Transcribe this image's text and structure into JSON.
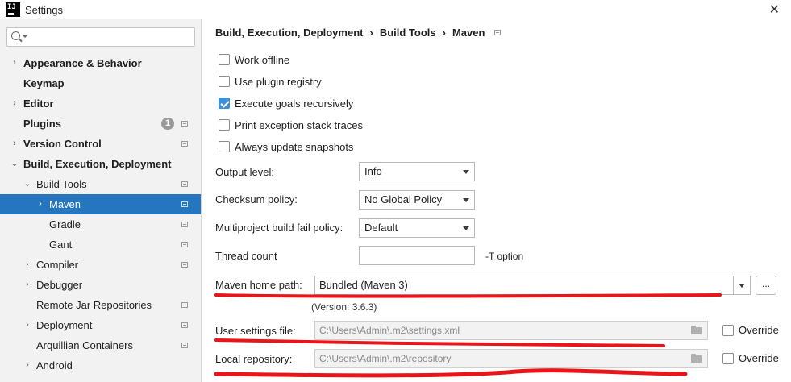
{
  "window": {
    "title": "Settings",
    "app_icon_text": "IJ"
  },
  "sidebar": {
    "search_placeholder": "",
    "items": [
      {
        "label": "Appearance & Behavior",
        "bold": true
      },
      {
        "label": "Keymap",
        "bold": true
      },
      {
        "label": "Editor",
        "bold": true
      },
      {
        "label": "Plugins",
        "bold": true,
        "badge": "1"
      },
      {
        "label": "Version Control",
        "bold": true
      },
      {
        "label": "Build, Execution, Deployment",
        "bold": true
      },
      {
        "label": "Build Tools"
      },
      {
        "label": "Maven",
        "selected": true
      },
      {
        "label": "Gradle"
      },
      {
        "label": "Gant"
      },
      {
        "label": "Compiler"
      },
      {
        "label": "Debugger"
      },
      {
        "label": "Remote Jar Repositories"
      },
      {
        "label": "Deployment"
      },
      {
        "label": "Arquillian Containers"
      },
      {
        "label": "Android"
      }
    ]
  },
  "breadcrumb": [
    "Build, Execution, Deployment",
    "Build Tools",
    "Maven"
  ],
  "options": {
    "work_offline": "Work offline",
    "use_plugin_registry": "Use plugin registry",
    "execute_goals_recursively": "Execute goals recursively",
    "print_exception_stack_traces": "Print exception stack traces",
    "always_update_snapshots": "Always update snapshots"
  },
  "form": {
    "output_level_label": "Output level:",
    "output_level_value": "Info",
    "checksum_policy_label": "Checksum policy:",
    "checksum_policy_value": "No Global Policy",
    "multiproject_label": "Multiproject build fail policy:",
    "multiproject_value": "Default",
    "thread_count_label": "Thread count",
    "thread_count_value": "",
    "thread_count_hint": "-T option",
    "maven_home_label": "Maven home path:",
    "maven_home_value": "Bundled (Maven 3)",
    "browse_label": "...",
    "version_text": "(Version: 3.6.3)",
    "user_settings_label": "User settings file:",
    "user_settings_value": "C:\\Users\\Admin\\.m2\\settings.xml",
    "local_repo_label": "Local repository:",
    "local_repo_value": "C:\\Users\\Admin\\.m2\\repository",
    "override_label": "Override"
  },
  "colors": {
    "selection": "#2675bf",
    "annotation": "#e8161b",
    "checkbox_checked": "#3d8fd8"
  }
}
